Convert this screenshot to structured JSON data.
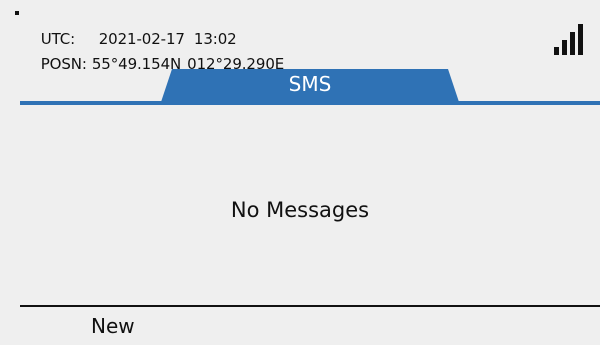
{
  "status": {
    "utc_label": "UTC:",
    "utc_date": "2021-02-17",
    "utc_time": "13:02",
    "posn_label": "POSN:",
    "latitude": "55°49.154N",
    "longitude": "012°29.290E",
    "signal_icon": "signal-strength-icon",
    "signal_level": 4
  },
  "tab": {
    "label": "SMS"
  },
  "content": {
    "empty_message": "No Messages"
  },
  "softkeys": {
    "left_label": "New"
  },
  "colors": {
    "accent": "#2f72b5",
    "background": "#efefef",
    "text": "#111111"
  }
}
